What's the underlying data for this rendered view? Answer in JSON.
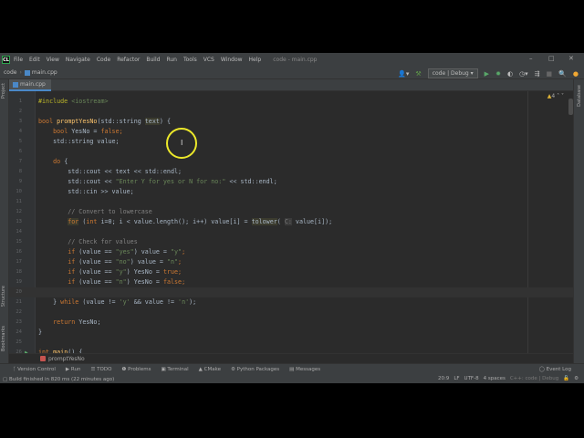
{
  "window": {
    "title": "code - main.cpp"
  },
  "menu": [
    "File",
    "Edit",
    "View",
    "Navigate",
    "Code",
    "Refactor",
    "Build",
    "Run",
    "Tools",
    "VCS",
    "Window",
    "Help"
  ],
  "navbar": {
    "project": "code",
    "file": "main.cpp"
  },
  "toolbar": {
    "run_config": "code | Debug"
  },
  "tabs": [
    {
      "label": "main.cpp"
    }
  ],
  "side_tools": {
    "left": [
      "Project",
      "Structure",
      "Bookmarks"
    ],
    "right": [
      "Database"
    ]
  },
  "inspections": {
    "warnings": "4"
  },
  "code": [
    {
      "n": "1",
      "t": [
        [
          "#include",
          "pp"
        ],
        [
          " ",
          ""
        ],
        [
          "<iostream>",
          "str"
        ]
      ]
    },
    {
      "n": "2",
      "t": []
    },
    {
      "n": "3",
      "t": [
        [
          "bool",
          "kw"
        ],
        [
          " ",
          ""
        ],
        [
          "promptYesNo",
          "fn"
        ],
        [
          "(std::string ",
          ""
        ],
        [
          "text",
          "hl"
        ],
        [
          ") {",
          ""
        ]
      ]
    },
    {
      "n": "4",
      "t": [
        [
          "    ",
          ""
        ],
        [
          "bool",
          "kw"
        ],
        [
          " YesNo = ",
          ""
        ],
        [
          "false",
          "kw"
        ],
        [
          ";",
          "kw"
        ]
      ]
    },
    {
      "n": "5",
      "t": [
        [
          "    std::string value;",
          ""
        ]
      ]
    },
    {
      "n": "6",
      "t": []
    },
    {
      "n": "7",
      "t": [
        [
          "    ",
          ""
        ],
        [
          "do",
          "kw"
        ],
        [
          " {",
          ""
        ]
      ]
    },
    {
      "n": "8",
      "t": [
        [
          "        std::cout << text << std::endl;",
          ""
        ]
      ]
    },
    {
      "n": "9",
      "t": [
        [
          "        std::cout << ",
          ""
        ],
        [
          "\"Enter Y for yes or N for no:\"",
          "str"
        ],
        [
          " << std::endl;",
          ""
        ]
      ]
    },
    {
      "n": "10",
      "t": [
        [
          "        std::cin >> value;",
          ""
        ]
      ]
    },
    {
      "n": "11",
      "t": []
    },
    {
      "n": "12",
      "t": [
        [
          "        ",
          ""
        ],
        [
          "// Convert to lowercase",
          "cm"
        ]
      ]
    },
    {
      "n": "13",
      "t": [
        [
          "        ",
          ""
        ],
        [
          "for",
          "hlkw"
        ],
        [
          " (",
          ""
        ],
        [
          "int",
          "kw"
        ],
        [
          " i=0; i < value.length(); i++) value[i] = ",
          ""
        ],
        [
          "tolower",
          "hl"
        ],
        [
          "( ",
          ""
        ],
        [
          "C:",
          "hint"
        ],
        [
          " value[i]);",
          ""
        ]
      ]
    },
    {
      "n": "14",
      "t": []
    },
    {
      "n": "15",
      "t": [
        [
          "        ",
          ""
        ],
        [
          "// Check for values",
          "cm"
        ]
      ]
    },
    {
      "n": "16",
      "t": [
        [
          "        ",
          ""
        ],
        [
          "if",
          "kw"
        ],
        [
          " (value == ",
          ""
        ],
        [
          "\"yes\"",
          "str"
        ],
        [
          ") value = ",
          ""
        ],
        [
          "\"y\"",
          "str"
        ],
        [
          ";",
          "kw"
        ]
      ]
    },
    {
      "n": "17",
      "t": [
        [
          "        ",
          ""
        ],
        [
          "if",
          "kw"
        ],
        [
          " (value == ",
          ""
        ],
        [
          "\"no\"",
          "str"
        ],
        [
          ") value = ",
          ""
        ],
        [
          "\"n\"",
          "str"
        ],
        [
          ";",
          "kw"
        ]
      ]
    },
    {
      "n": "18",
      "t": [
        [
          "        ",
          ""
        ],
        [
          "if",
          "kw"
        ],
        [
          " (value == ",
          ""
        ],
        [
          "\"y\"",
          "str"
        ],
        [
          ") YesNo = ",
          ""
        ],
        [
          "true",
          "kw"
        ],
        [
          ";",
          "kw"
        ]
      ]
    },
    {
      "n": "19",
      "t": [
        [
          "        ",
          ""
        ],
        [
          "if",
          "kw"
        ],
        [
          " (value == ",
          ""
        ],
        [
          "\"n\"",
          "str"
        ],
        [
          ") YesNo = ",
          ""
        ],
        [
          "false",
          "kw"
        ],
        [
          ";",
          "kw"
        ]
      ]
    },
    {
      "n": "20",
      "t": []
    },
    {
      "n": "21",
      "t": [
        [
          "    } ",
          ""
        ],
        [
          "while",
          "kw"
        ],
        [
          " (value != ",
          ""
        ],
        [
          "'y'",
          "str"
        ],
        [
          " && value != ",
          ""
        ],
        [
          "'n'",
          "str"
        ],
        [
          ");",
          ""
        ]
      ]
    },
    {
      "n": "22",
      "t": []
    },
    {
      "n": "23",
      "t": [
        [
          "    ",
          ""
        ],
        [
          "return",
          "kw"
        ],
        [
          " YesNo;",
          ""
        ]
      ]
    },
    {
      "n": "24",
      "t": [
        [
          "}",
          ""
        ]
      ]
    },
    {
      "n": "25",
      "t": []
    },
    {
      "n": "26",
      "t": [
        [
          "int",
          "kw"
        ],
        [
          " ",
          ""
        ],
        [
          "main",
          "fn"
        ],
        [
          "() {",
          ""
        ]
      ]
    }
  ],
  "current_line": "20",
  "breadcrumb": {
    "function": "promptYesNo"
  },
  "tool_windows": [
    "Version Control",
    "Run",
    "TODO",
    "Problems",
    "Terminal",
    "CMake",
    "Python Packages",
    "Messages"
  ],
  "event_log": "Event Log",
  "status": {
    "message": "Build finished in 820 ms (22 minutes ago)",
    "position": "20:9",
    "line_sep": "LF",
    "encoding": "UTF-8",
    "indent": "4 spaces",
    "context": "C++: code | Debug"
  }
}
